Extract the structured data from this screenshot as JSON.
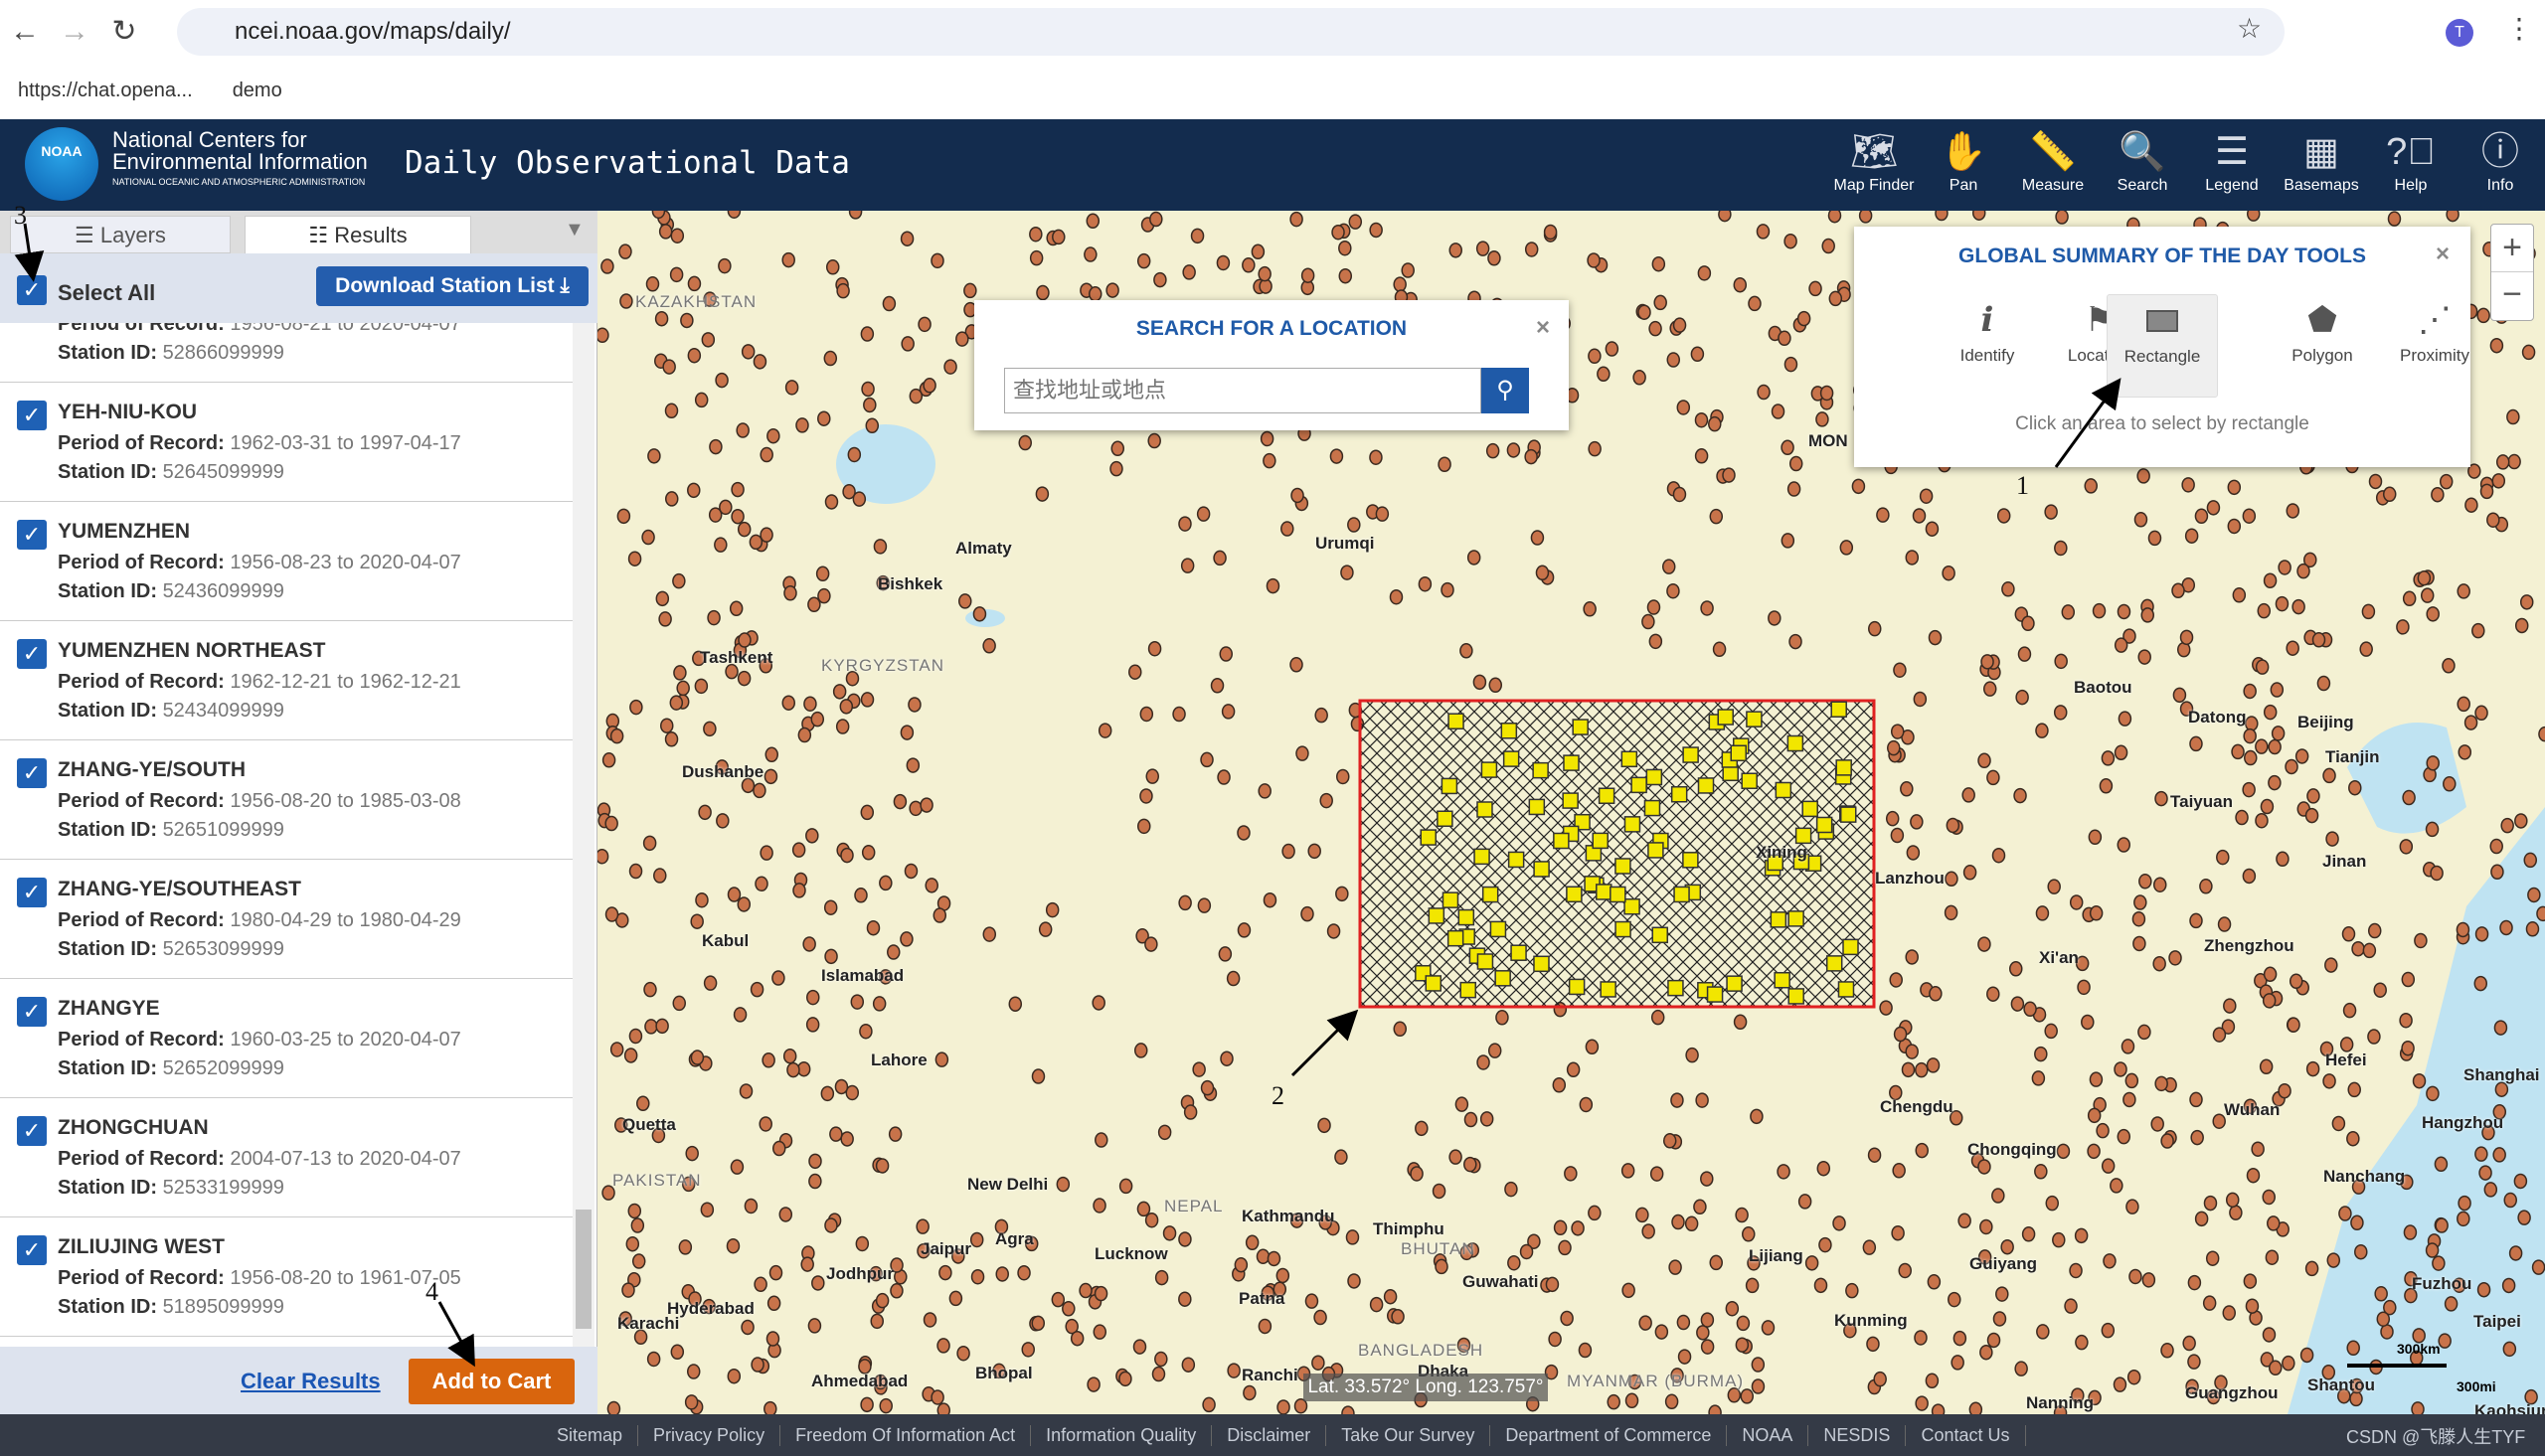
{
  "browser": {
    "url": "ncei.noaa.gov/maps/daily/",
    "bookmarks": [
      "https://chat.opena...",
      "demo"
    ]
  },
  "header": {
    "logo_text": "NOAA",
    "org_line1": "National Centers for",
    "org_line2": "Environmental Information",
    "org_line3": "NATIONAL OCEANIC AND ATMOSPHERIC ADMINISTRATION",
    "app_title": "Daily Observational Data",
    "tools": [
      {
        "label": "Map Finder",
        "icon": "map-finder-icon"
      },
      {
        "label": "Pan",
        "icon": "hand-icon"
      },
      {
        "label": "Measure",
        "icon": "ruler-icon"
      },
      {
        "label": "Search",
        "icon": "search-icon"
      },
      {
        "label": "Legend",
        "icon": "list-icon"
      },
      {
        "label": "Basemaps",
        "icon": "grid-icon"
      },
      {
        "label": "Help",
        "icon": "help-icon"
      },
      {
        "label": "Info",
        "icon": "info-icon"
      }
    ]
  },
  "panel": {
    "tabs": [
      {
        "label": "Layers",
        "active": false
      },
      {
        "label": "Results",
        "active": true
      }
    ],
    "select_all": "Select All",
    "download": "Download Station List",
    "period_label": "Period of Record:",
    "station_label": "Station ID:",
    "items": [
      {
        "name": "",
        "period": "1956-08-21 to 2020-04-07",
        "id": "52866099999"
      },
      {
        "name": "YEH-NIU-KOU",
        "period": "1962-03-31 to 1997-04-17",
        "id": "52645099999"
      },
      {
        "name": "YUMENZHEN",
        "period": "1956-08-23 to 2020-04-07",
        "id": "52436099999"
      },
      {
        "name": "YUMENZHEN NORTHEAST",
        "period": "1962-12-21 to 1962-12-21",
        "id": "52434099999"
      },
      {
        "name": "ZHANG-YE/SOUTH",
        "period": "1956-08-20 to 1985-03-08",
        "id": "52651099999"
      },
      {
        "name": "ZHANG-YE/SOUTHEAST",
        "period": "1980-04-29 to 1980-04-29",
        "id": "52653099999"
      },
      {
        "name": "ZHANGYE",
        "period": "1960-03-25 to 2020-04-07",
        "id": "52652099999"
      },
      {
        "name": "ZHONGCHUAN",
        "period": "2004-07-13 to 2020-04-07",
        "id": "52533199999"
      },
      {
        "name": "ZILIUJING WEST",
        "period": "1956-08-20 to 1961-07-05",
        "id": "51895099999"
      }
    ],
    "clear": "Clear Results",
    "add_to_cart": "Add to Cart"
  },
  "search_popup": {
    "title": "SEARCH FOR A LOCATION",
    "placeholder": "查找地址或地点"
  },
  "tools_popup": {
    "title": "GLOBAL SUMMARY OF THE DAY TOOLS",
    "tools": [
      {
        "label": "Identify",
        "icon": "identify-icon"
      },
      {
        "label": "Location",
        "icon": "flag-icon"
      },
      {
        "label": "Rectangle",
        "icon": "rectangle-icon",
        "active": true
      },
      {
        "label": "Polygon",
        "icon": "polygon-icon"
      },
      {
        "label": "Proximity",
        "icon": "proximity-icon"
      }
    ],
    "hint": "Click an area to select by rectangle"
  },
  "map": {
    "coords": "Lat. 33.572° Long. 123.757°",
    "scale_km": "300km",
    "scale_mi": "300mi",
    "station_color": "#c8734a",
    "selected_color": "#f2e600",
    "selection_color": "#e02020",
    "labels": [
      "KAZAKHSTAN",
      "Urumqi",
      "Bishkek",
      "Almaty",
      "Tashkent",
      "KYRGYZSTAN",
      "Dushanbe",
      "Kabul",
      "Islamabad",
      "Lahore",
      "Quetta",
      "PAKISTAN",
      "New Delhi",
      "NEPAL",
      "Kathmandu",
      "Thimphu",
      "BHUTAN",
      "Jaipur",
      "Agra",
      "Lucknow",
      "Jodhpur",
      "Karachi",
      "Hyderabad",
      "Patna",
      "Guwahati",
      "Ahmedabad",
      "Bhopal",
      "Ranchi",
      "Dhaka",
      "BANGLADESH",
      "MYANMAR (BURMA)",
      "Xining",
      "Lanzhou",
      "Xi'an",
      "Chengdu",
      "Chongqing",
      "Lijiang",
      "Kunming",
      "Guiyang",
      "Nanning",
      "Guangzhou",
      "Wuhan",
      "Zhengzhou",
      "Taiyuan",
      "Beijing",
      "Tianjin",
      "Jinan",
      "Shanghai",
      "Hangzhou",
      "Nanchang",
      "Hefei",
      "Fuzhou",
      "Taipei",
      "Shantou",
      "Kaohsiung",
      "Baotou",
      "Datong",
      "MON"
    ]
  },
  "annotations": [
    "1",
    "2",
    "3",
    "4"
  ],
  "footer": {
    "links": [
      "Sitemap",
      "Privacy Policy",
      "Freedom Of Information Act",
      "Information Quality",
      "Disclaimer",
      "Take Our Survey",
      "Department of Commerce",
      "NOAA",
      "NESDIS",
      "Contact Us"
    ],
    "watermark": "CSDN @飞滕人生TYF"
  }
}
